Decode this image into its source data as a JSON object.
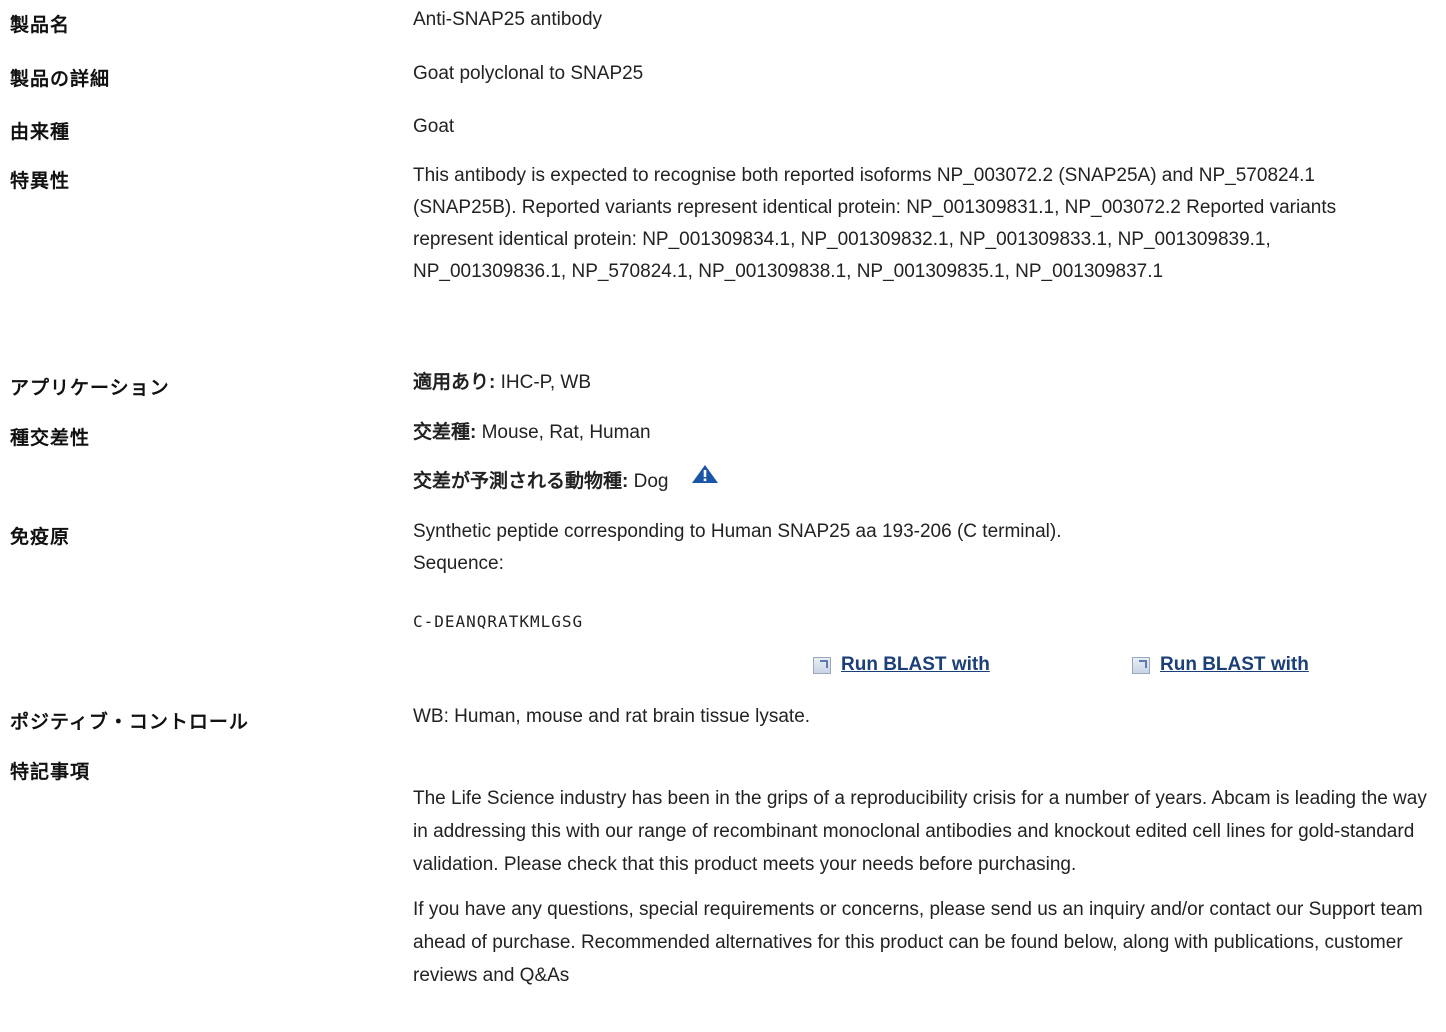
{
  "rows": {
    "product_name": {
      "label": "製品名",
      "value": "Anti-SNAP25 antibody"
    },
    "product_detail": {
      "label": "製品の詳細",
      "value": "Goat polyclonal to SNAP25"
    },
    "host": {
      "label": "由来種",
      "value": "Goat"
    },
    "specificity": {
      "label": "特異性",
      "value": "This antibody is expected to recognise both reported isoforms NP_003072.2 (SNAP25A) and NP_570824.1 (SNAP25B). Reported variants represent identical protein: NP_001309831.1, NP_003072.2 Reported variants represent identical protein: NP_001309834.1, NP_001309832.1, NP_001309833.1, NP_001309839.1, NP_001309836.1, NP_570824.1, NP_001309838.1, NP_001309835.1, NP_001309837.1"
    },
    "applications": {
      "label": "アプリケーション",
      "prefix": "適用あり:",
      "value": " IHC-P, WB"
    },
    "reactivity": {
      "label": "種交差性",
      "prefix": "交差種:",
      "value": " Mouse, Rat, Human",
      "predicted_prefix": "交差が予測される動物種:",
      "predicted_value": " Dog"
    },
    "immunogen": {
      "label": "免疫原",
      "value": "Synthetic peptide corresponding to Human SNAP25 aa 193-206 (C terminal).",
      "sequence_label": "Sequence:",
      "sequence": "C-DEANQRATKMLGSG"
    },
    "blast": {
      "link1": "Run BLAST with",
      "link2": "Run BLAST with"
    },
    "positive_control": {
      "label": "ポジティブ・コントロール",
      "value": "WB: Human, mouse and rat brain tissue lysate."
    },
    "notes": {
      "label": "特記事項",
      "p1": "The Life Science industry has been in the grips of a reproducibility crisis for a number of years. Abcam is leading the way in addressing this with our range of recombinant monoclonal antibodies and knockout edited cell lines for gold-standard validation. Please check that this product meets your needs before purchasing.",
      "p2": "If you have any questions, special requirements or concerns, please send us an inquiry and/or contact our Support team ahead of purchase. Recommended alternatives for this product can be found below, along with publications, customer reviews and Q&As"
    }
  },
  "icons": {
    "warning": "warning-triangle-icon",
    "external": "external-link-icon"
  },
  "colors": {
    "link": "#1b3f77",
    "warning": "#1a56a8"
  }
}
